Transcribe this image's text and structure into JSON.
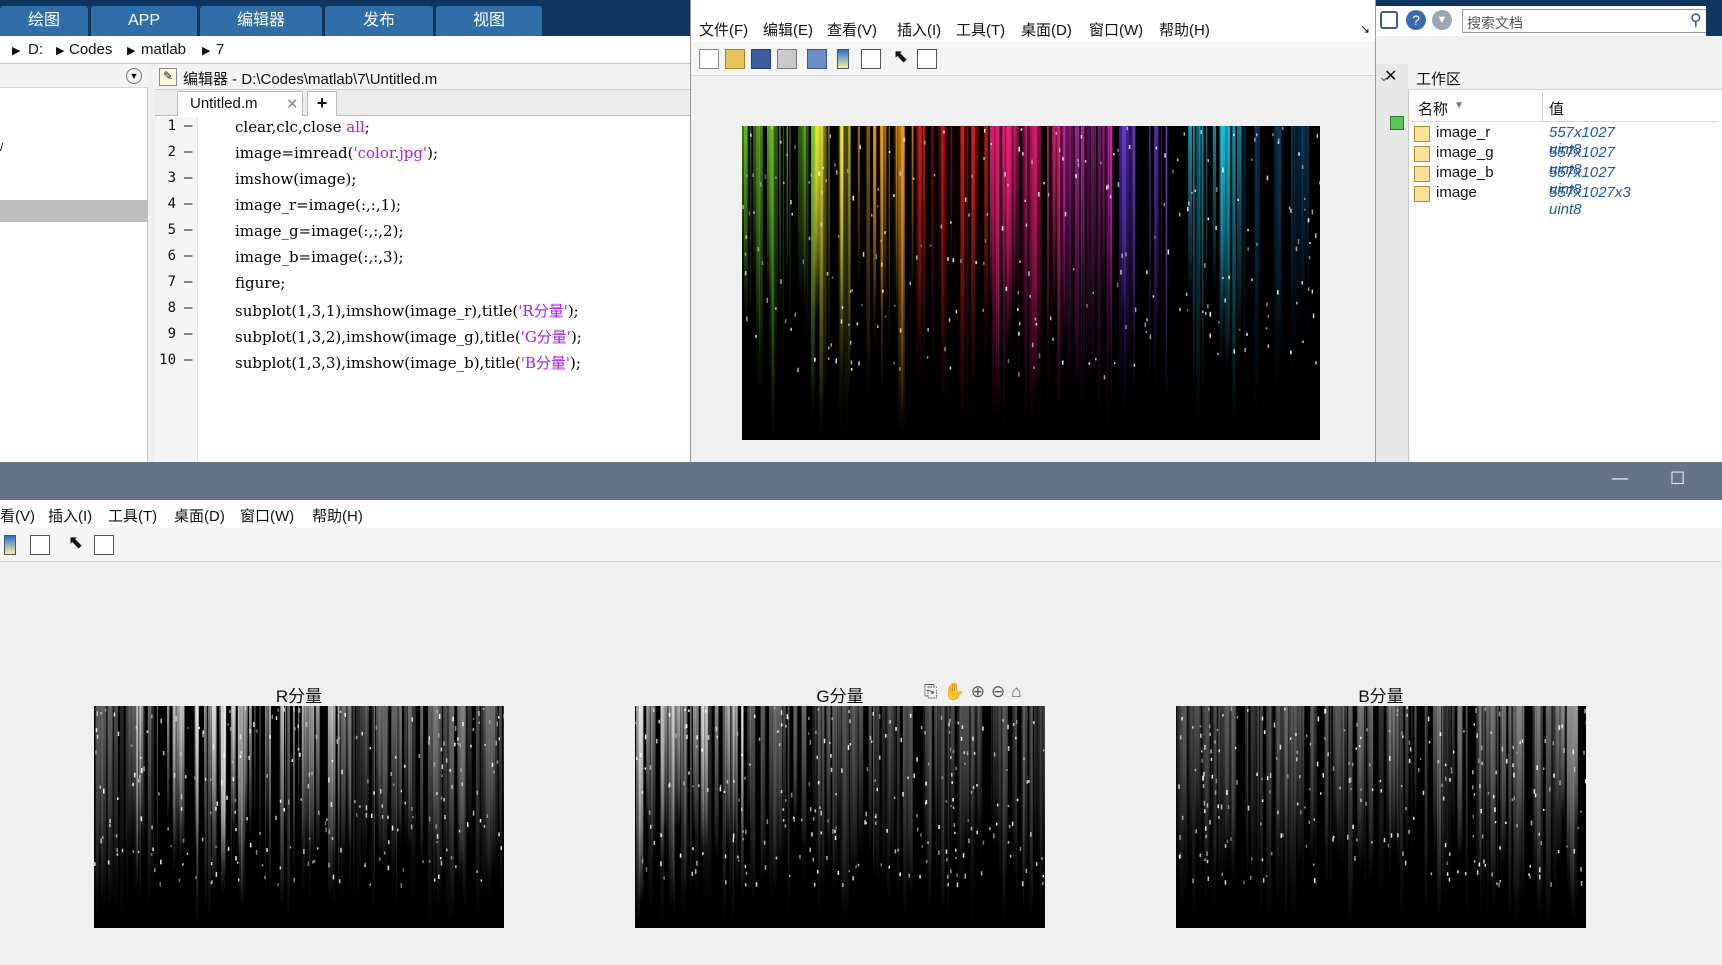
{
  "ribbon": {
    "tabs": [
      "绘图",
      "APP",
      "编辑器",
      "发布",
      "视图"
    ]
  },
  "breadcrumb": [
    "D:",
    "Codes",
    "matlab",
    "7"
  ],
  "search": {
    "placeholder": "搜索文档"
  },
  "editor": {
    "title": "编辑器 - D:\\Codes\\matlab\\7\\Untitled.m",
    "tab": "Untitled.m",
    "add_tab": "+",
    "lines": [
      {
        "n": "1",
        "pre": "clear,clc,close ",
        "str": "all",
        "post": ";"
      },
      {
        "n": "2",
        "pre": "image=imread(",
        "str": "'color.jpg'",
        "post": ");"
      },
      {
        "n": "3",
        "pre": "imshow(image);",
        "str": "",
        "post": ""
      },
      {
        "n": "4",
        "pre": "image_r=image(:,:,1);",
        "str": "",
        "post": ""
      },
      {
        "n": "5",
        "pre": "image_g=image(:,:,2);",
        "str": "",
        "post": ""
      },
      {
        "n": "6",
        "pre": "image_b=image(:,:,3);",
        "str": "",
        "post": ""
      },
      {
        "n": "7",
        "pre": "figure;",
        "str": "",
        "post": ""
      },
      {
        "n": "8",
        "pre": "subplot(1,3,1),imshow(image_r),title(",
        "str": "'R分量'",
        "post": ");"
      },
      {
        "n": "9",
        "pre": "subplot(1,3,2),imshow(image_g),title(",
        "str": "'G分量'",
        "post": ");"
      },
      {
        "n": "10",
        "pre": "subplot(1,3,3),imshow(image_b),title(",
        "str": "'B分量'",
        "post": ");"
      }
    ]
  },
  "figure1": {
    "menu": [
      "文件(F)",
      "编辑(E)",
      "查看(V)",
      "插入(I)",
      "工具(T)",
      "桌面(D)",
      "窗口(W)",
      "帮助(H)"
    ]
  },
  "workspace": {
    "title": "工作区",
    "col_name": "名称",
    "col_value": "值",
    "rows": [
      {
        "name": "image_r",
        "value": "557x1027 uint8"
      },
      {
        "name": "image_g",
        "value": "557x1027 uint8"
      },
      {
        "name": "image_b",
        "value": "557x1027 uint8"
      },
      {
        "name": "image",
        "value": "557x1027x3 uint8"
      }
    ]
  },
  "figure2": {
    "menu": [
      "看(V)",
      "插入(I)",
      "工具(T)",
      "桌面(D)",
      "窗口(W)",
      "帮助(H)"
    ],
    "subplots": [
      {
        "title": "R分量"
      },
      {
        "title": "G分量"
      },
      {
        "title": "B分量"
      }
    ],
    "window_buttons": [
      "—",
      "☐"
    ]
  },
  "colors": {
    "ribbon_bg": "#10355e",
    "ribbon_tab": "#2f6ea8",
    "figure_bar": "#647389",
    "string_purple": "#a020f0",
    "ws_value_blue": "#1f56a8"
  }
}
